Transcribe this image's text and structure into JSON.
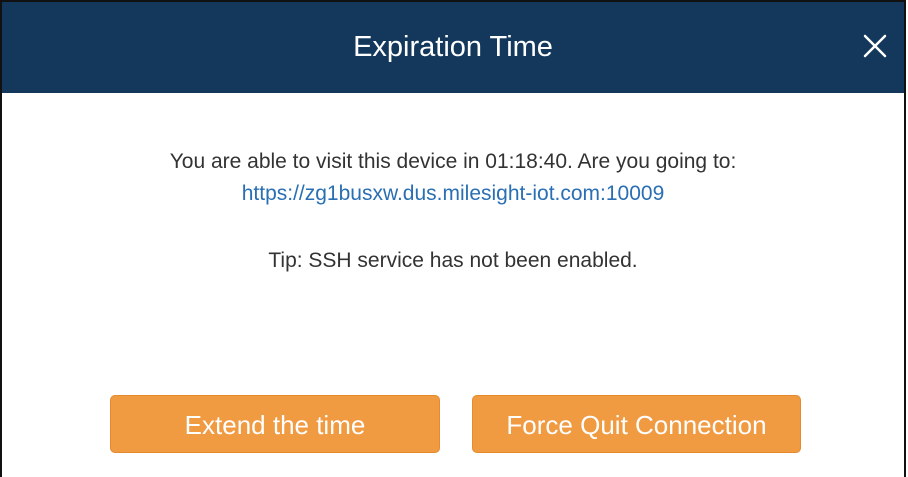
{
  "dialog": {
    "title": "Expiration Time",
    "close_icon": "close-icon",
    "message": "You are able to visit this device in 01:18:40. Are you going to:",
    "link": "https://zg1busxw.dus.milesight-iot.com:10009",
    "tip": "Tip: SSH service has not been enabled.",
    "buttons": {
      "extend_label": "Extend the time",
      "quit_label": "Force Quit Connection"
    }
  },
  "colors": {
    "header_bg": "#13385c",
    "button_bg": "#f09a41",
    "link": "#2a6fb3",
    "text": "#333333"
  }
}
